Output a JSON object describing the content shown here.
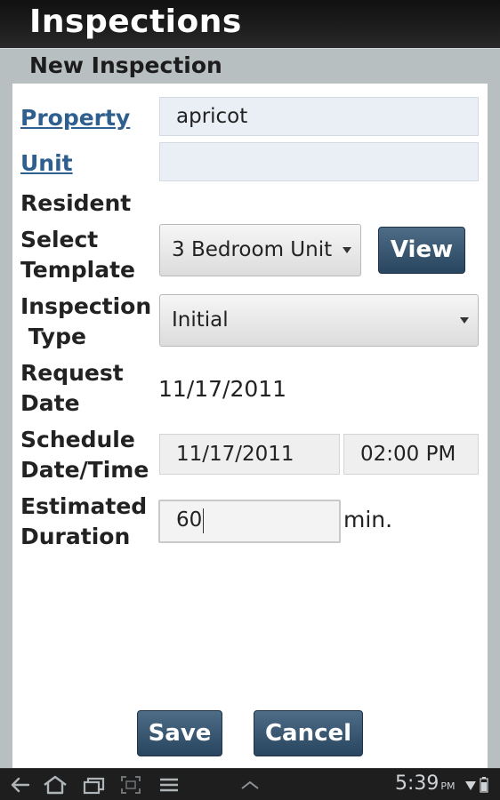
{
  "app": {
    "title": "Inspections",
    "subtitle": "New Inspection"
  },
  "form": {
    "property": {
      "label": "Property",
      "value": "apricot"
    },
    "unit": {
      "label": "Unit",
      "value": ""
    },
    "resident": {
      "label": "Resident"
    },
    "template": {
      "label": "Select\nTemplate",
      "selected": "3 Bedroom Unit",
      "view_label": "View"
    },
    "inspection_type": {
      "label": "Inspection\n Type",
      "selected": "Initial"
    },
    "request_date": {
      "label": "Request\nDate",
      "value": "11/17/2011"
    },
    "schedule": {
      "label": "Schedule\nDate/Time",
      "date": "11/17/2011",
      "time": "02:00 PM"
    },
    "duration": {
      "label": "Estimated\nDuration",
      "value": "60",
      "unit": "min."
    }
  },
  "actions": {
    "save_label": "Save",
    "cancel_label": "Cancel"
  },
  "statusbar": {
    "time": "5:39",
    "ampm": "PM",
    "icons": [
      "back-icon",
      "home-icon",
      "recent-apps-icon",
      "screenshot-icon",
      "menu-icon",
      "chevron-up-icon",
      "wifi-icon",
      "battery-icon"
    ]
  }
}
